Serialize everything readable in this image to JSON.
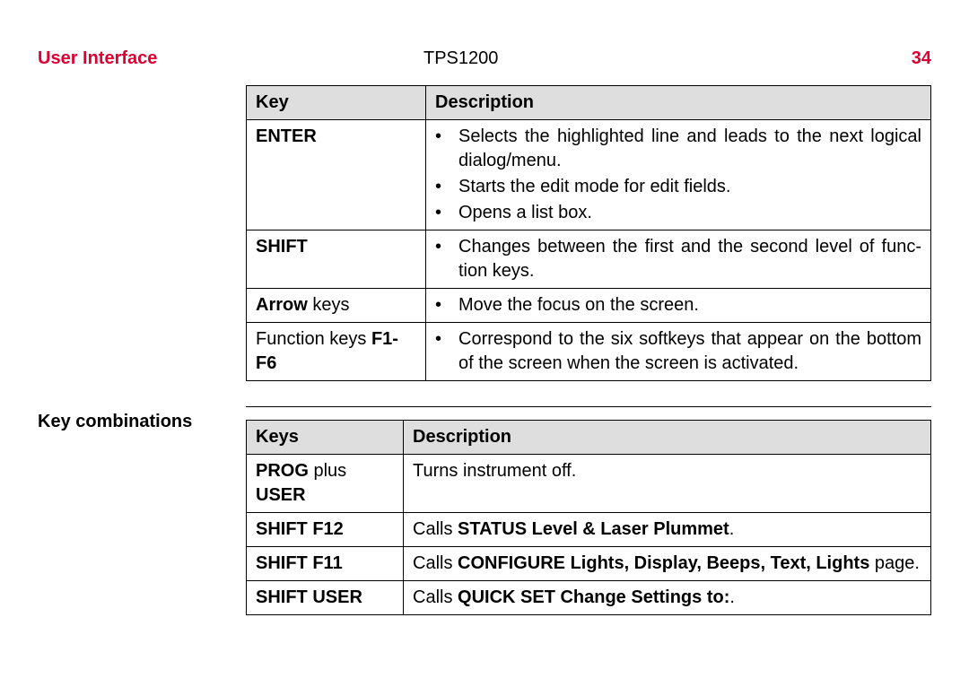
{
  "header": {
    "section": "User Interface",
    "doc_title": "TPS1200",
    "page_number": "34"
  },
  "labels": {
    "key_combinations": "Key combinations"
  },
  "table1": {
    "header_key": "Key",
    "header_desc": "Description",
    "rows": [
      {
        "key_segments": [
          {
            "text": "ENTER",
            "bold": true
          }
        ],
        "desc_items": [
          "Selects the highlighted line and leads to the next logical dialog/menu.",
          "Starts the edit mode for edit fields.",
          "Opens a list box."
        ]
      },
      {
        "key_segments": [
          {
            "text": "SHIFT",
            "bold": true
          }
        ],
        "desc_items": [
          "Changes between the first and the second level of func­tion keys."
        ]
      },
      {
        "key_segments": [
          {
            "text": "Arrow",
            "bold": true
          },
          {
            "text": " keys",
            "bold": false
          }
        ],
        "desc_items": [
          "Move the focus on the screen."
        ]
      },
      {
        "key_segments": [
          {
            "text": "Function keys ",
            "bold": false
          },
          {
            "text": "F1-F6",
            "bold": true
          }
        ],
        "desc_items": [
          "Correspond to the six softkeys that appear on the bottom of the screen when the screen is activated."
        ]
      }
    ]
  },
  "table2": {
    "header_keys": "Keys",
    "header_desc": "Description",
    "rows": [
      {
        "key_segments": [
          {
            "text": "PROG",
            "bold": true
          },
          {
            "text": " plus ",
            "bold": false
          },
          {
            "text": "USER",
            "bold": true
          }
        ],
        "desc_segments": [
          {
            "text": "Turns instrument off.",
            "bold": false
          }
        ]
      },
      {
        "key_segments": [
          {
            "text": "SHIFT F12",
            "bold": true
          }
        ],
        "desc_segments": [
          {
            "text": "Calls ",
            "bold": false
          },
          {
            "text": "STATUS Level & Laser Plummet",
            "bold": true
          },
          {
            "text": ".",
            "bold": false
          }
        ]
      },
      {
        "key_segments": [
          {
            "text": "SHIFT F11",
            "bold": true
          }
        ],
        "desc_segments": [
          {
            "text": "Calls ",
            "bold": false
          },
          {
            "text": "CONFIGURE Lights, Display, Beeps, Text, Lights",
            "bold": true
          },
          {
            "text": " page.",
            "bold": false
          }
        ]
      },
      {
        "key_segments": [
          {
            "text": "SHIFT USER",
            "bold": true
          }
        ],
        "desc_segments": [
          {
            "text": "Calls ",
            "bold": false
          },
          {
            "text": "QUICK SET Change Settings to:",
            "bold": true
          },
          {
            "text": ".",
            "bold": false
          }
        ]
      }
    ]
  }
}
